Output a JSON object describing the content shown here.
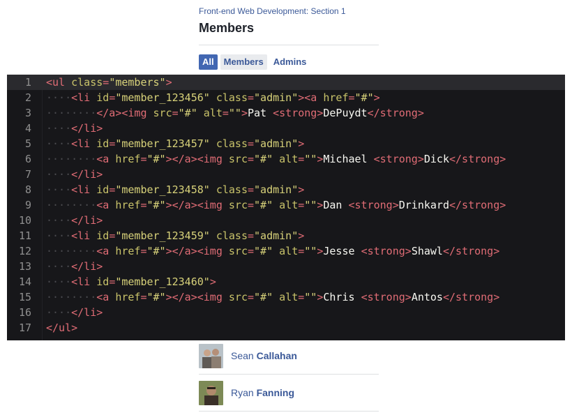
{
  "header": {
    "breadcrumb": "Front-end Web Development: Section 1",
    "title": "Members"
  },
  "tabs": [
    {
      "label": "All",
      "state": "active"
    },
    {
      "label": "Members",
      "state": "hover"
    },
    {
      "label": "Admins",
      "state": "normal"
    }
  ],
  "editor": {
    "lines": [
      {
        "n": "1",
        "tokens": [
          [
            "tag",
            "<ul "
          ],
          [
            "attr",
            "class"
          ],
          [
            "tag",
            "="
          ],
          [
            "str",
            "\"members\""
          ],
          [
            "tag",
            ">"
          ]
        ]
      },
      {
        "n": "2",
        "tokens": [
          [
            "guide",
            "····"
          ],
          [
            "tag",
            "<li "
          ],
          [
            "attr",
            "id"
          ],
          [
            "tag",
            "="
          ],
          [
            "str",
            "\"member_123456\""
          ],
          [
            "txt",
            " "
          ],
          [
            "attr",
            "class"
          ],
          [
            "tag",
            "="
          ],
          [
            "str",
            "\"admin\""
          ],
          [
            "tag",
            "><a "
          ],
          [
            "attr",
            "href"
          ],
          [
            "tag",
            "="
          ],
          [
            "str",
            "\"#\""
          ],
          [
            "tag",
            ">"
          ]
        ]
      },
      {
        "n": "3",
        "tokens": [
          [
            "guide",
            "········"
          ],
          [
            "tag",
            "</a><img "
          ],
          [
            "attr",
            "src"
          ],
          [
            "tag",
            "="
          ],
          [
            "str",
            "\"#\""
          ],
          [
            "txt",
            " "
          ],
          [
            "attr",
            "alt"
          ],
          [
            "tag",
            "="
          ],
          [
            "str",
            "\"\""
          ],
          [
            "tag",
            ">"
          ],
          [
            "txt",
            "Pat "
          ],
          [
            "tag",
            "<strong>"
          ],
          [
            "txt",
            "DePuydt"
          ],
          [
            "tag",
            "</strong>"
          ]
        ]
      },
      {
        "n": "4",
        "tokens": [
          [
            "guide",
            "····"
          ],
          [
            "tag",
            "</li>"
          ]
        ]
      },
      {
        "n": "5",
        "tokens": [
          [
            "guide",
            "····"
          ],
          [
            "tag",
            "<li "
          ],
          [
            "attr",
            "id"
          ],
          [
            "tag",
            "="
          ],
          [
            "str",
            "\"member_123457\""
          ],
          [
            "txt",
            " "
          ],
          [
            "attr",
            "class"
          ],
          [
            "tag",
            "="
          ],
          [
            "str",
            "\"admin\""
          ],
          [
            "tag",
            ">"
          ]
        ]
      },
      {
        "n": "6",
        "tokens": [
          [
            "guide",
            "········"
          ],
          [
            "tag",
            "<a "
          ],
          [
            "attr",
            "href"
          ],
          [
            "tag",
            "="
          ],
          [
            "str",
            "\"#\""
          ],
          [
            "tag",
            "></a><img "
          ],
          [
            "attr",
            "src"
          ],
          [
            "tag",
            "="
          ],
          [
            "str",
            "\"#\""
          ],
          [
            "txt",
            " "
          ],
          [
            "attr",
            "alt"
          ],
          [
            "tag",
            "="
          ],
          [
            "str",
            "\"\""
          ],
          [
            "tag",
            ">"
          ],
          [
            "txt",
            "Michael "
          ],
          [
            "tag",
            "<strong>"
          ],
          [
            "txt",
            "Dick"
          ],
          [
            "tag",
            "</strong>"
          ]
        ]
      },
      {
        "n": "7",
        "tokens": [
          [
            "guide",
            "····"
          ],
          [
            "tag",
            "</li>"
          ]
        ]
      },
      {
        "n": "8",
        "tokens": [
          [
            "guide",
            "····"
          ],
          [
            "tag",
            "<li "
          ],
          [
            "attr",
            "id"
          ],
          [
            "tag",
            "="
          ],
          [
            "str",
            "\"member_123458\""
          ],
          [
            "txt",
            " "
          ],
          [
            "attr",
            "class"
          ],
          [
            "tag",
            "="
          ],
          [
            "str",
            "\"admin\""
          ],
          [
            "tag",
            ">"
          ]
        ]
      },
      {
        "n": "9",
        "tokens": [
          [
            "guide",
            "········"
          ],
          [
            "tag",
            "<a "
          ],
          [
            "attr",
            "href"
          ],
          [
            "tag",
            "="
          ],
          [
            "str",
            "\"#\""
          ],
          [
            "tag",
            "></a><img "
          ],
          [
            "attr",
            "src"
          ],
          [
            "tag",
            "="
          ],
          [
            "str",
            "\"#\""
          ],
          [
            "txt",
            " "
          ],
          [
            "attr",
            "alt"
          ],
          [
            "tag",
            "="
          ],
          [
            "str",
            "\"\""
          ],
          [
            "tag",
            ">"
          ],
          [
            "txt",
            "Dan "
          ],
          [
            "tag",
            "<strong>"
          ],
          [
            "txt",
            "Drinkard"
          ],
          [
            "tag",
            "</strong>"
          ]
        ]
      },
      {
        "n": "10",
        "tokens": [
          [
            "guide",
            "····"
          ],
          [
            "tag",
            "</li>"
          ]
        ]
      },
      {
        "n": "11",
        "tokens": [
          [
            "guide",
            "····"
          ],
          [
            "tag",
            "<li "
          ],
          [
            "attr",
            "id"
          ],
          [
            "tag",
            "="
          ],
          [
            "str",
            "\"member_123459\""
          ],
          [
            "txt",
            " "
          ],
          [
            "attr",
            "class"
          ],
          [
            "tag",
            "="
          ],
          [
            "str",
            "\"admin\""
          ],
          [
            "tag",
            ">"
          ]
        ]
      },
      {
        "n": "12",
        "tokens": [
          [
            "guide",
            "········"
          ],
          [
            "tag",
            "<a "
          ],
          [
            "attr",
            "href"
          ],
          [
            "tag",
            "="
          ],
          [
            "str",
            "\"#\""
          ],
          [
            "tag",
            "></a><img "
          ],
          [
            "attr",
            "src"
          ],
          [
            "tag",
            "="
          ],
          [
            "str",
            "\"#\""
          ],
          [
            "txt",
            " "
          ],
          [
            "attr",
            "alt"
          ],
          [
            "tag",
            "="
          ],
          [
            "str",
            "\"\""
          ],
          [
            "tag",
            ">"
          ],
          [
            "txt",
            "Jesse "
          ],
          [
            "tag",
            "<strong>"
          ],
          [
            "txt",
            "Shawl"
          ],
          [
            "tag",
            "</strong>"
          ]
        ]
      },
      {
        "n": "13",
        "tokens": [
          [
            "guide",
            "····"
          ],
          [
            "tag",
            "</li>"
          ]
        ]
      },
      {
        "n": "14",
        "tokens": [
          [
            "guide",
            "····"
          ],
          [
            "tag",
            "<li "
          ],
          [
            "attr",
            "id"
          ],
          [
            "tag",
            "="
          ],
          [
            "str",
            "\"member_123460\""
          ],
          [
            "tag",
            ">"
          ]
        ]
      },
      {
        "n": "15",
        "tokens": [
          [
            "guide",
            "········"
          ],
          [
            "tag",
            "<a "
          ],
          [
            "attr",
            "href"
          ],
          [
            "tag",
            "="
          ],
          [
            "str",
            "\"#\""
          ],
          [
            "tag",
            "></a><img "
          ],
          [
            "attr",
            "src"
          ],
          [
            "tag",
            "="
          ],
          [
            "str",
            "\"#\""
          ],
          [
            "txt",
            " "
          ],
          [
            "attr",
            "alt"
          ],
          [
            "tag",
            "="
          ],
          [
            "str",
            "\"\""
          ],
          [
            "tag",
            ">"
          ],
          [
            "txt",
            "Chris "
          ],
          [
            "tag",
            "<strong>"
          ],
          [
            "txt",
            "Antos"
          ],
          [
            "tag",
            "</strong>"
          ]
        ]
      },
      {
        "n": "16",
        "tokens": [
          [
            "guide",
            "····"
          ],
          [
            "tag",
            "</li>"
          ]
        ]
      },
      {
        "n": "17",
        "tokens": [
          [
            "tag",
            "</ul>"
          ]
        ]
      }
    ],
    "current_line": "1"
  },
  "members": [
    {
      "first": "Sean",
      "last": "Callahan",
      "avatar_colors": [
        "#6b6560",
        "#a89585"
      ]
    },
    {
      "first": "Ryan",
      "last": "Fanning",
      "avatar_colors": [
        "#6b7a4a",
        "#3a3028"
      ]
    }
  ],
  "colors": {
    "link": "#3b5998",
    "tab_active_bg": "#4267b2",
    "editor_bg": "#17171a",
    "tag": "#e06c75",
    "attr": "#c9c36a",
    "string": "#d8d27a"
  }
}
